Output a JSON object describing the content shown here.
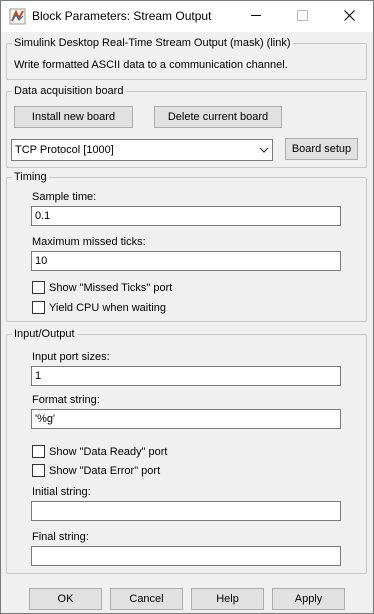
{
  "window": {
    "title": "Block Parameters: Stream Output",
    "minimize_icon": "minimize-icon",
    "maximize_icon": "maximize-icon",
    "close_icon": "close-icon"
  },
  "description": {
    "legend": "Simulink Desktop Real-Time Stream Output (mask) (link)",
    "text": "Write formatted ASCII data to a communication channel."
  },
  "board": {
    "legend": "Data acquisition board",
    "install_label": "Install new board",
    "delete_label": "Delete current board",
    "selected": "TCP Protocol [1000]",
    "setup_label": "Board setup"
  },
  "timing": {
    "legend": "Timing",
    "sample_time_label": "Sample time:",
    "sample_time_value": "0.1",
    "missed_ticks_label": "Maximum missed ticks:",
    "missed_ticks_value": "10",
    "show_missed_label": "Show \"Missed Ticks\" port",
    "show_missed_checked": false,
    "yield_label": "Yield CPU when waiting",
    "yield_checked": false
  },
  "io": {
    "legend": "Input/Output",
    "port_sizes_label": "Input port sizes:",
    "port_sizes_value": "1",
    "format_label": "Format string:",
    "format_value": "'%g'",
    "data_ready_label": "Show \"Data Ready\" port",
    "data_ready_checked": false,
    "data_error_label": "Show \"Data Error\" port",
    "data_error_checked": false,
    "initial_label": "Initial string:",
    "initial_value": "",
    "final_label": "Final string:",
    "final_value": ""
  },
  "buttons": {
    "ok": "OK",
    "cancel": "Cancel",
    "help": "Help",
    "apply": "Apply"
  }
}
